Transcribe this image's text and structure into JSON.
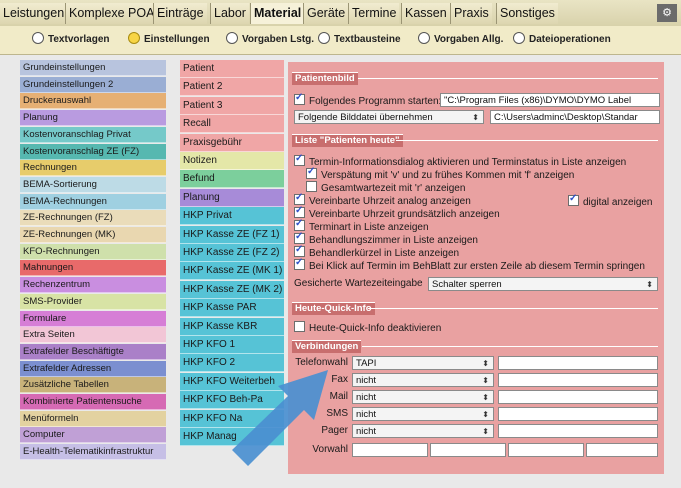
{
  "main_tabs": [
    {
      "label": "Leistungen"
    },
    {
      "label": "Komplexe POA"
    },
    {
      "label": "Einträge"
    },
    {
      "label": "Labor"
    },
    {
      "label": "Material"
    },
    {
      "label": "Geräte"
    },
    {
      "label": "Termine"
    },
    {
      "label": "Kassen"
    },
    {
      "label": "Praxis"
    },
    {
      "label": "Sonstiges"
    }
  ],
  "sub_tabs": [
    {
      "label": "Textvorlagen",
      "selected": false
    },
    {
      "label": "Einstellungen",
      "selected": true
    },
    {
      "label": "Vorgaben Lstg.",
      "selected": false
    },
    {
      "label": "Textbausteine",
      "selected": false
    },
    {
      "label": "Vorgaben Allg.",
      "selected": false
    },
    {
      "label": "Dateioperationen",
      "selected": false
    }
  ],
  "category_list": [
    {
      "label": "Grundeinstellungen",
      "color": "#b8c4de"
    },
    {
      "label": "Grundeinstellungen 2",
      "color": "#9aaed4"
    },
    {
      "label": "Druckerauswahl",
      "color": "#e6b074"
    },
    {
      "label": "Planung",
      "color": "#b99be0"
    },
    {
      "label": "Kostenvoranschlag Privat",
      "color": "#75c9c9"
    },
    {
      "label": "Kostenvoranschlag ZE (FZ)",
      "color": "#56b8b0"
    },
    {
      "label": "Rechnungen",
      "color": "#e7cc6b"
    },
    {
      "label": "BEMA-Sortierung",
      "color": "#bddbe6"
    },
    {
      "label": "BEMA-Rechnungen",
      "color": "#9fd0e1"
    },
    {
      "label": "ZE-Rechnungen (FZ)",
      "color": "#eadcba"
    },
    {
      "label": "ZE-Rechnungen (MK)",
      "color": "#e9d7b0"
    },
    {
      "label": "KFO-Rechnungen",
      "color": "#cfe0ab"
    },
    {
      "label": "Mahnungen",
      "color": "#e86a6a"
    },
    {
      "label": "Rechenzentrum",
      "color": "#c98ee0"
    },
    {
      "label": "SMS-Provider",
      "color": "#d8e3a5"
    },
    {
      "label": "Formulare",
      "color": "#d67ed6"
    },
    {
      "label": "Extra Seiten",
      "color": "#f2c6d6"
    },
    {
      "label": "Extrafelder Beschäftigte",
      "color": "#aa80c8"
    },
    {
      "label": "Extrafelder Adressen",
      "color": "#7b8fd0"
    },
    {
      "label": "Zusätzliche Tabellen",
      "color": "#c8b27a"
    },
    {
      "label": "Kombinierte Patientensuche",
      "color": "#d66ab4"
    },
    {
      "label": "Menüformeln",
      "color": "#e3d2a0"
    },
    {
      "label": "Computer",
      "color": "#c0a0d6"
    },
    {
      "label": "E-Health-Telematikinfrastruktur",
      "color": "#c6bfe6"
    }
  ],
  "subcategory_list": [
    {
      "label": "Patient",
      "color": "#f0a6a6"
    },
    {
      "label": "Patient 2",
      "color": "#f0a6a6"
    },
    {
      "label": "Patient 3",
      "color": "#f0a6a6"
    },
    {
      "label": "Recall",
      "color": "#f0a6a6"
    },
    {
      "label": "Praxisgebühr",
      "color": "#f0a6a6"
    },
    {
      "label": "Notizen",
      "color": "#e4e7a8"
    },
    {
      "label": "Befund",
      "color": "#7ccf9c"
    },
    {
      "label": "Planung",
      "color": "#a78bd8"
    },
    {
      "label": "HKP Privat",
      "color": "#56c3d6"
    },
    {
      "label": "HKP Kasse ZE (FZ 1)",
      "color": "#56c3d6"
    },
    {
      "label": "HKP Kasse ZE (FZ 2)",
      "color": "#56c3d6"
    },
    {
      "label": "HKP Kasse ZE (MK 1)",
      "color": "#56c3d6"
    },
    {
      "label": "HKP Kasse ZE (MK 2)",
      "color": "#56c3d6"
    },
    {
      "label": "HKP Kasse PAR",
      "color": "#56c3d6"
    },
    {
      "label": "HKP Kasse KBR",
      "color": "#56c3d6"
    },
    {
      "label": "HKP KFO 1",
      "color": "#56c3d6"
    },
    {
      "label": "HKP KFO 2",
      "color": "#56c3d6"
    },
    {
      "label": "HKP KFO Weiterbeh",
      "color": "#56c3d6"
    },
    {
      "label": "HKP KFO Beh-Pa",
      "color": "#56c3d6"
    },
    {
      "label": "HKP KFO Na",
      "color": "#56c3d6"
    },
    {
      "label": "HKP Manag",
      "color": "#56c3d6"
    }
  ],
  "patientenbild": {
    "title": "Patientenbild",
    "start_program_label": "Folgendes Programm starten:",
    "start_program_checked": true,
    "start_program_path": "\"C:\\Program Files (x86)\\DYMO\\DYMO Label",
    "image_option": "Folgende Bilddatei übernehmen",
    "image_path": "C:\\Users\\adminc\\Desktop\\Standar"
  },
  "liste": {
    "title": "Liste \"Patienten heute\"",
    "options": [
      {
        "label": "Termin-Informationsdialog aktivieren und Terminstatus in Liste anzeigen",
        "checked": true,
        "indent": 0
      },
      {
        "label": "Verspätung mit 'v' und zu frühes Kommen mit 'f' anzeigen",
        "checked": true,
        "indent": 1
      },
      {
        "label": "Gesamtwartezeit mit 'r' anzeigen",
        "checked": false,
        "indent": 1
      },
      {
        "label": "Vereinbarte Uhrzeit analog anzeigen",
        "checked": true,
        "indent": 0
      },
      {
        "label": "Vereinbarte Uhrzeit grundsätzlich anzeigen",
        "checked": true,
        "indent": 0
      },
      {
        "label": "Terminart in Liste anzeigen",
        "checked": true,
        "indent": 0
      },
      {
        "label": "Behandlungszimmer in Liste anzeigen",
        "checked": true,
        "indent": 0
      },
      {
        "label": "Behandlerkürzel in Liste anzeigen",
        "checked": true,
        "indent": 0
      },
      {
        "label": "Bei Klick auf Termin im BehBlatt zur ersten Zeile ab diesem Termin springen",
        "checked": true,
        "indent": 0
      }
    ],
    "digital_label": "digital anzeigen",
    "digital_checked": true,
    "wait_input_label": "Gesicherte Wartezeiteingabe",
    "wait_input_value": "Schalter sperren"
  },
  "quickinfo": {
    "title": "Heute-Quick-Info",
    "disable_label": "Heute-Quick-Info deaktivieren",
    "disable_checked": false
  },
  "verbindungen": {
    "title": "Verbindungen",
    "rows": [
      {
        "label": "Telefonwahl",
        "value": "TAPI"
      },
      {
        "label": "Fax",
        "value": "nicht"
      },
      {
        "label": "Mail",
        "value": "nicht"
      },
      {
        "label": "SMS",
        "value": "nicht"
      },
      {
        "label": "Pager",
        "value": "nicht"
      }
    ],
    "vorwahl_label": "Vorwahl"
  }
}
